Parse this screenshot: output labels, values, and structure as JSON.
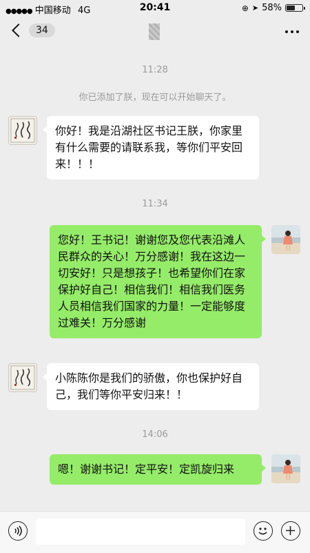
{
  "status_bar": {
    "carrier": "中国移动",
    "network": "4G",
    "time": "20:41",
    "battery": "58%",
    "battery_level": 0.58
  },
  "nav": {
    "unread_count": "34"
  },
  "chat": {
    "ts1": "11:28",
    "system_msg": "你已添加了朕，现在可以开始聊天了。",
    "msg1": "你好！我是沿湖社区书记王朕，你家里有什么需要的请联系我，等你们平安回来！！！",
    "ts2": "11:34",
    "msg2": "您好！王书记！谢谢您及您代表沿滩人民群众的关心！万分感谢！我在这边一切安好！只是想孩子！也希望你们在家保护好自己！相信我们！相信我们医务人员相信我们国家的力量！一定能够度过难关！万分感谢",
    "msg3": "小陈陈你是我们的骄傲，你也保护好自己，我们等你平安归来！！",
    "ts3": "14:06",
    "msg4": "嗯！谢谢书记！定平安！定凯旋归来"
  },
  "colors": {
    "background": "#ededed",
    "outgoing_bubble": "#95ec69",
    "incoming_bubble": "#ffffff",
    "timestamp": "#9a9a9a"
  },
  "icons": [
    "back-chevron-icon",
    "more-dots-icon",
    "voice-icon",
    "emoji-icon",
    "plus-icon",
    "location-icon",
    "alarm-icon",
    "battery-icon"
  ]
}
